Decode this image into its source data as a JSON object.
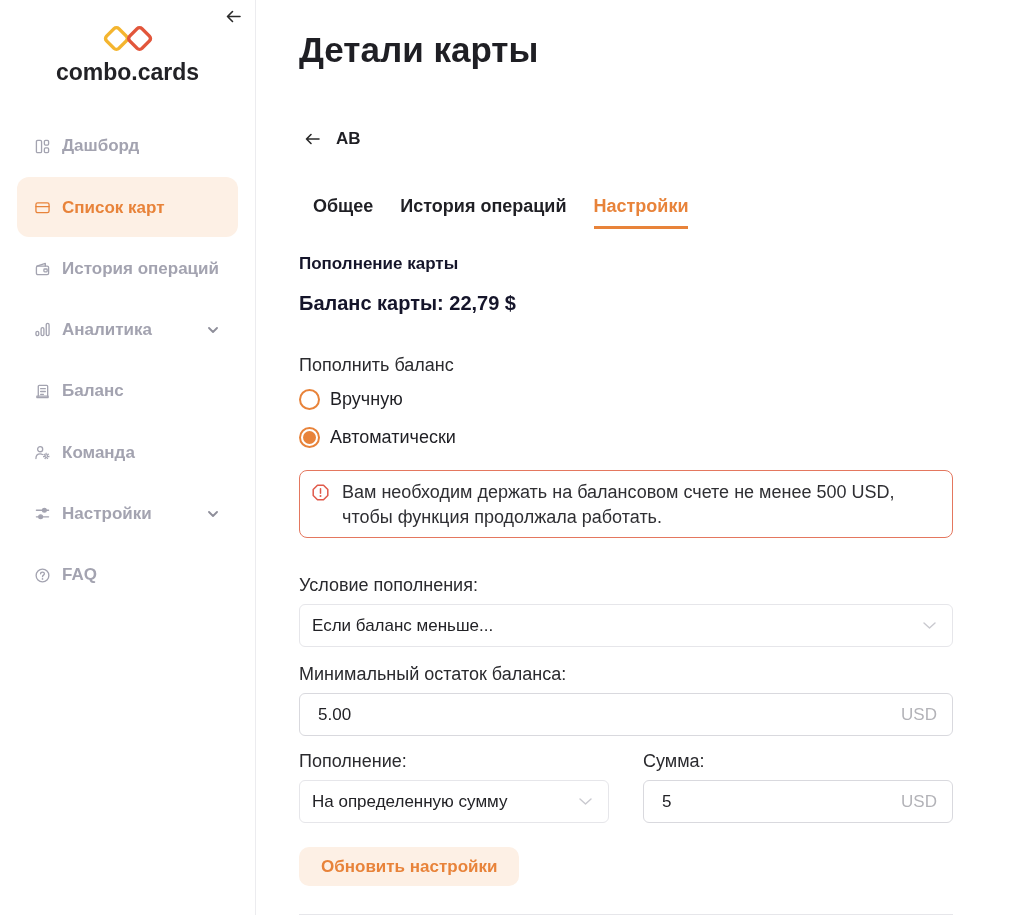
{
  "sidebar": {
    "brand": "combo.cards",
    "items": [
      {
        "label": "Дашборд",
        "kind": "link",
        "selected": false
      },
      {
        "label": "Список карт",
        "kind": "link",
        "selected": true
      },
      {
        "label": "История операций",
        "kind": "link",
        "selected": false
      },
      {
        "label": "Аналитика",
        "kind": "group",
        "selected": false,
        "expanded": false
      },
      {
        "label": "Баланс",
        "kind": "link",
        "selected": false
      },
      {
        "label": "Команда",
        "kind": "link",
        "selected": false
      },
      {
        "label": "Настройки",
        "kind": "group",
        "selected": false,
        "expanded": false
      },
      {
        "label": "FAQ",
        "kind": "link",
        "selected": false
      }
    ]
  },
  "page": {
    "title": "Детали карты",
    "back_label": "AB"
  },
  "tabs": [
    {
      "label": "Общее",
      "selected": false
    },
    {
      "label": "История операций",
      "selected": false
    },
    {
      "label": "Настройки",
      "selected": true
    }
  ],
  "topup": {
    "heading": "Пополнение карты",
    "balance": "Баланс карты: 22,79 $",
    "mode": {
      "label": "Пополнить баланс",
      "options": [
        {
          "label": "Вручную",
          "selected": false
        },
        {
          "label": "Автоматически",
          "selected": true
        }
      ]
    },
    "alert": "Вам необходим держать на балансовом счете не менее 500 USD, чтобы функция продолжала работать.",
    "fields": [
      {
        "kind": "select",
        "label": "Условие пополнения:",
        "value": "Если баланс меньше..."
      },
      {
        "kind": "input",
        "label": "Минимальный остаток баланса:",
        "value": "5.00",
        "unit": "USD"
      }
    ],
    "field_pair": [
      {
        "kind": "select",
        "label": "Пополнение:",
        "value": "На определенную сумму"
      },
      {
        "kind": "input",
        "label": "Сумма:",
        "value": "5",
        "unit": "USD"
      }
    ],
    "submit": "Обновить настройки"
  }
}
